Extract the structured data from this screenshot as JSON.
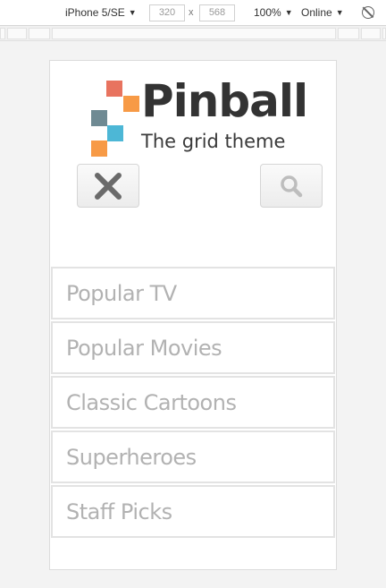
{
  "devtools": {
    "device": "iPhone 5/SE",
    "width": "320",
    "height": "568",
    "zoom": "100%",
    "network": "Online",
    "caret": "▼",
    "times": "x"
  },
  "site": {
    "title": "Pinball",
    "tagline": "The grid theme",
    "logo_colors": [
      "#e8735f",
      "#f79a46",
      "#6f8a93",
      "#4db7d6",
      "#f79a46"
    ]
  },
  "nav": {
    "items": [
      {
        "label": "Popular TV"
      },
      {
        "label": "Popular Movies"
      },
      {
        "label": "Classic Cartoons"
      },
      {
        "label": "Superheroes"
      },
      {
        "label": "Staff Picks"
      }
    ]
  },
  "icons": {
    "close": "close-icon",
    "search": "search-icon"
  }
}
